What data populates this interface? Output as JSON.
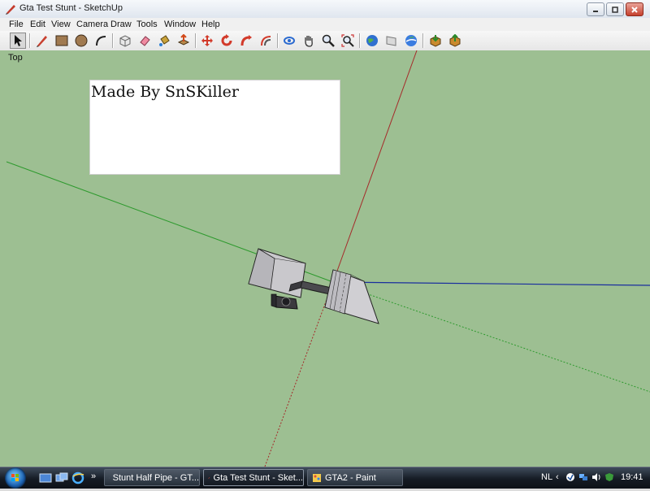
{
  "window": {
    "title": "Gta Test Stunt - SketchUp"
  },
  "menu": [
    "File",
    "Edit",
    "View",
    "Camera",
    "Draw",
    "Tools",
    "Window",
    "Help"
  ],
  "toolbar": {
    "tools": [
      "select",
      "line",
      "rectangle",
      "circle",
      "arc",
      "make-component",
      "eraser",
      "paint-bucket",
      "push-pull",
      "move",
      "rotate",
      "follow-me",
      "offset",
      "orbit",
      "pan",
      "zoom",
      "zoom-extents",
      "previous-view",
      "next-view",
      "get-models",
      "share-model",
      "place-model",
      "get-photo-texture"
    ]
  },
  "viewport": {
    "view_name": "Top",
    "note_text": "Made By SnSKiller",
    "background": "#9dbf92",
    "axis_colors": {
      "red": "#a52a2a",
      "green": "#2e9a2e",
      "blue": "#1a2e9e"
    }
  },
  "taskbar": {
    "buttons": [
      {
        "label": "Stunt Half Pipe - GT...",
        "active": false
      },
      {
        "label": "Gta Test Stunt - Sket...",
        "active": true
      },
      {
        "label": "GTA2 - Paint",
        "active": false
      }
    ],
    "language": "NL",
    "clock": "19:41"
  }
}
